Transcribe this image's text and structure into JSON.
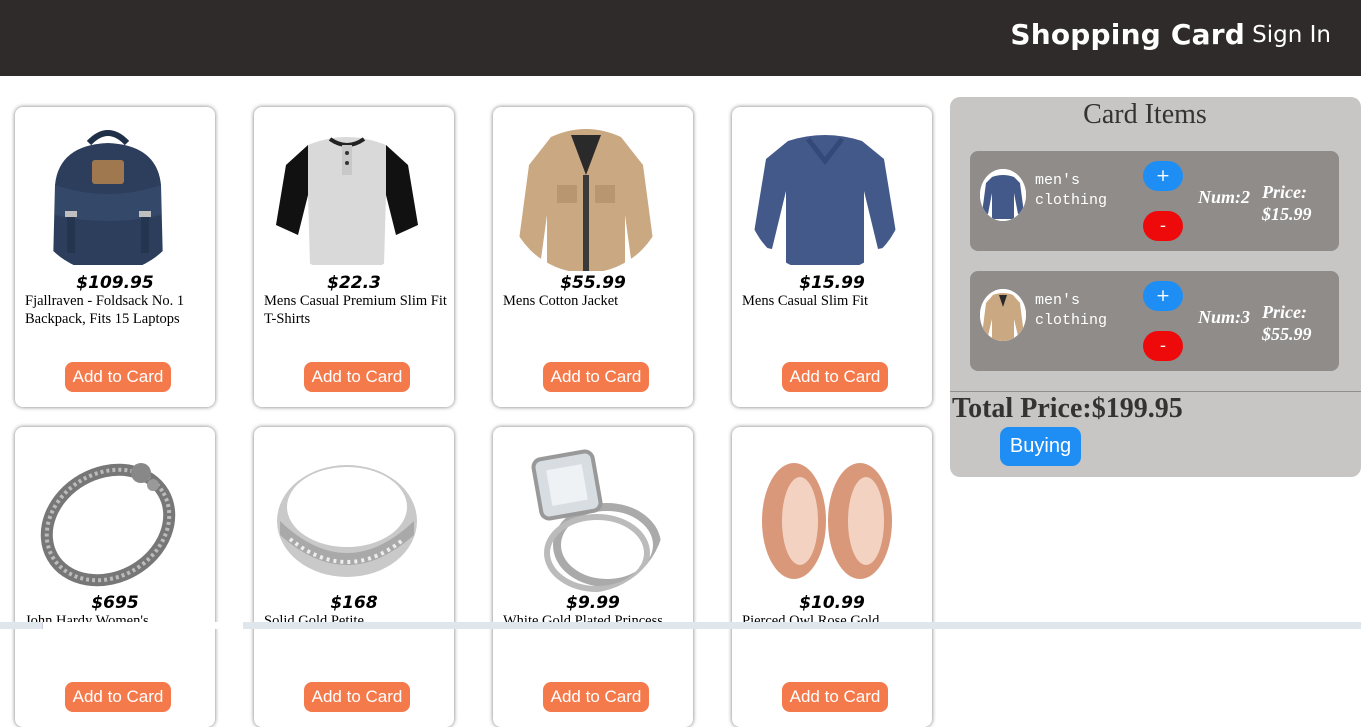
{
  "header": {
    "brand": "Shopping Card",
    "signin": "Sign In"
  },
  "products": [
    {
      "price": "$109.95",
      "title": "Fjallraven - Foldsack No. 1 Backpack, Fits 15 Laptops",
      "button": "Add to Card",
      "image": "backpack"
    },
    {
      "price": "$22.3",
      "title": "Mens Casual Premium Slim Fit T-Shirts",
      "button": "Add to Card",
      "image": "henley-tshirt"
    },
    {
      "price": "$55.99",
      "title": "Mens Cotton Jacket",
      "button": "Add to Card",
      "image": "cotton-jacket"
    },
    {
      "price": "$15.99",
      "title": "Mens Casual Slim Fit",
      "button": "Add to Card",
      "image": "longsleeve-shirt"
    },
    {
      "price": "$695",
      "title": "John Hardy Women's",
      "button": "Add to Card",
      "image": "dragon-bracelet"
    },
    {
      "price": "$168",
      "title": "Solid Gold Petite",
      "button": "Add to Card",
      "image": "silver-ring"
    },
    {
      "price": "$9.99",
      "title": "White Gold Plated Princess",
      "button": "Add to Card",
      "image": "diamond-ring"
    },
    {
      "price": "$10.99",
      "title": "Pierced Owl Rose Gold",
      "button": "Add to Card",
      "image": "rose-gold-earrings"
    }
  ],
  "cart": {
    "heading": "Card Items",
    "items": [
      {
        "category": "men's clothing",
        "num": "Num:2",
        "price_label": "Price:",
        "price": "$15.99",
        "plus": "+",
        "minus": "-",
        "image": "longsleeve-shirt"
      },
      {
        "category": "men's clothing",
        "num": "Num:3",
        "price_label": "Price:",
        "price": "$55.99",
        "plus": "+",
        "minus": "-",
        "image": "cotton-jacket"
      }
    ],
    "total": "Total Price:$199.95",
    "buy_button": "Buying"
  },
  "colors": {
    "header_bg": "#2f2b2a",
    "add_button": "#f47a4c",
    "cart_bg": "#c8c6c4",
    "cart_item_bg": "#8f8c8a",
    "blue_button": "#1e8ef5",
    "red_button": "#ee0a0a"
  }
}
